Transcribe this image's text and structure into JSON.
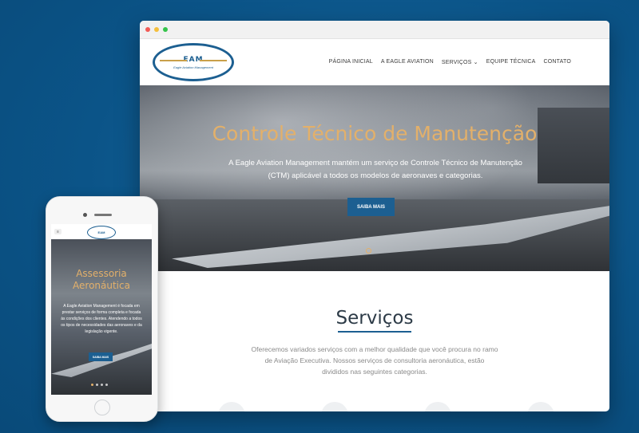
{
  "desktop": {
    "logo": {
      "mark": "EAM",
      "subtitle": "Eagle Aviation Management"
    },
    "nav": [
      "PÁGINA INICIAL",
      "A EAGLE AVIATION",
      "SERVIÇOS ⌄",
      "EQUIPE TÉCNICA",
      "CONTATO"
    ],
    "hero": {
      "title": "Controle Técnico de Manutenção",
      "text": "A Eagle Aviation Management mantém um serviço de Controle Técnico de Manutenção (CTM) aplicável a todos os modelos de aeronaves e categorias.",
      "button": "SAIBA MAIS"
    },
    "services": {
      "title": "Serviços",
      "text": "Oferecemos variados serviços com a melhor qualidade que você procura no ramo de Aviação Executiva. Nossos serviços de consultoria aeronáutica, estão divididos nas seguintes categorias."
    }
  },
  "mobile": {
    "menu_icon": "≡",
    "logo_mark": "EAM",
    "hero": {
      "title": "Assessoria Aeronáutica",
      "text": "A Eagle Aviation Management é focada em prestar serviços de forma completa e focada às condições dos clientes. Atendendo a todos os tipos de necessidades das aeronaves e da legislação vigente.",
      "button": "SAIBA MAIS"
    }
  },
  "colors": {
    "accent": "#1c5f91",
    "gold": "#e3b06a",
    "background": "#0d5a8e"
  }
}
